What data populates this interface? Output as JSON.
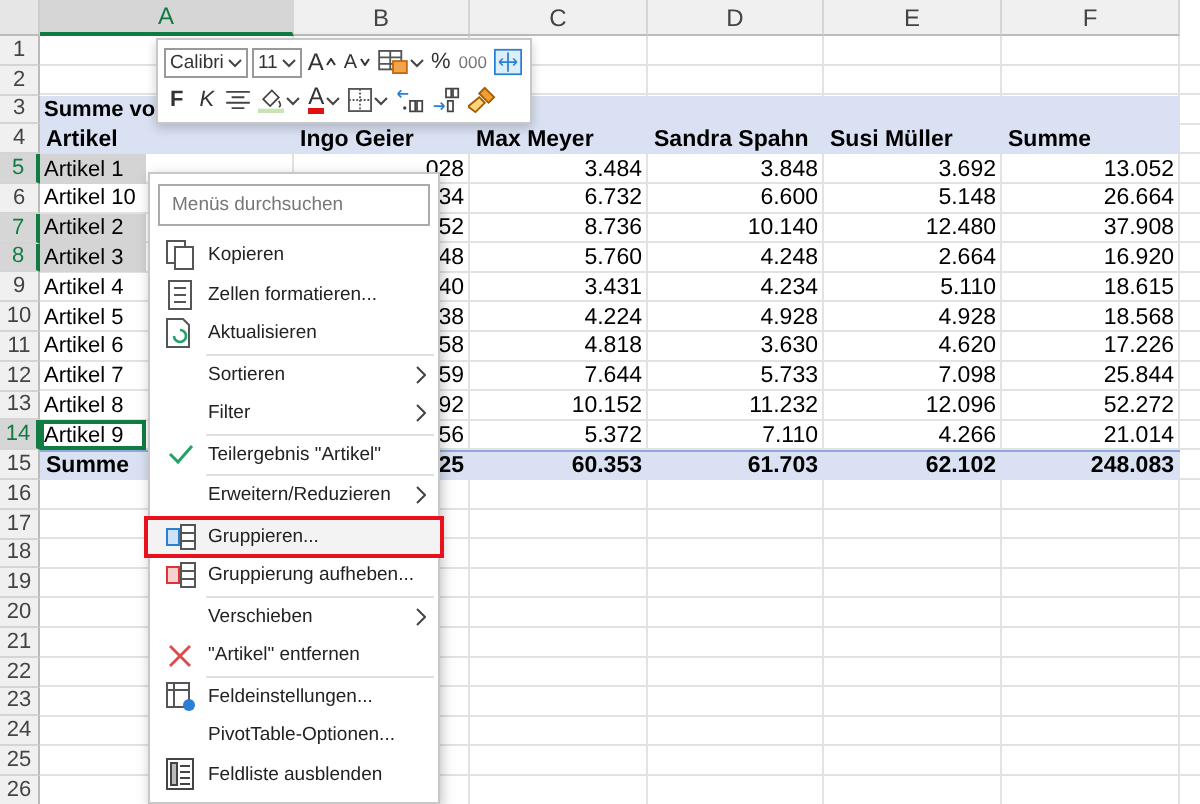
{
  "columns": [
    {
      "label": "A",
      "selected": true
    },
    {
      "label": "B",
      "selected": false
    },
    {
      "label": "C",
      "selected": false
    },
    {
      "label": "D",
      "selected": false
    },
    {
      "label": "E",
      "selected": false
    },
    {
      "label": "F",
      "selected": false
    }
  ],
  "row_headers": [
    {
      "label": "1",
      "selected": false
    },
    {
      "label": "2",
      "selected": false
    },
    {
      "label": "3",
      "selected": false
    },
    {
      "label": "4",
      "selected": false
    },
    {
      "label": "5",
      "selected": true
    },
    {
      "label": "6",
      "selected": false
    },
    {
      "label": "7",
      "selected": true
    },
    {
      "label": "8",
      "selected": true
    },
    {
      "label": "9",
      "selected": false
    },
    {
      "label": "10",
      "selected": false
    },
    {
      "label": "11",
      "selected": false
    },
    {
      "label": "12",
      "selected": false
    },
    {
      "label": "13",
      "selected": false
    },
    {
      "label": "14",
      "selected": true
    },
    {
      "label": "15",
      "selected": false
    },
    {
      "label": "16",
      "selected": false
    },
    {
      "label": "17",
      "selected": false
    },
    {
      "label": "18",
      "selected": false
    },
    {
      "label": "19",
      "selected": false
    },
    {
      "label": "20",
      "selected": false
    },
    {
      "label": "21",
      "selected": false
    },
    {
      "label": "22",
      "selected": false
    },
    {
      "label": "23",
      "selected": false
    },
    {
      "label": "24",
      "selected": false
    },
    {
      "label": "25",
      "selected": false
    },
    {
      "label": "26",
      "selected": false
    }
  ],
  "pivot": {
    "title": "Summe vo",
    "header": [
      "Artikel",
      "Ingo Geier",
      "Max Meyer",
      "Sandra Spahn",
      "Susi Müller",
      "Summe"
    ],
    "rows": [
      {
        "cells": [
          "Artikel 1",
          "028",
          "3.484",
          "3.848",
          "3.692",
          "13.052"
        ],
        "selected": true,
        "active": false
      },
      {
        "cells": [
          "Artikel 10",
          "34",
          "6.732",
          "6.600",
          "5.148",
          "26.664"
        ],
        "selected": false,
        "active": false
      },
      {
        "cells": [
          "Artikel 2",
          "52",
          "8.736",
          "10.140",
          "12.480",
          "37.908"
        ],
        "selected": true,
        "active": false
      },
      {
        "cells": [
          "Artikel 3",
          "48",
          "5.760",
          "4.248",
          "2.664",
          "16.920"
        ],
        "selected": true,
        "active": false
      },
      {
        "cells": [
          "Artikel 4",
          "40",
          "3.431",
          "4.234",
          "5.110",
          "18.615"
        ],
        "selected": false,
        "active": false
      },
      {
        "cells": [
          "Artikel 5",
          "38",
          "4.224",
          "4.928",
          "4.928",
          "18.568"
        ],
        "selected": false,
        "active": false
      },
      {
        "cells": [
          "Artikel 6",
          "58",
          "4.818",
          "3.630",
          "4.620",
          "17.226"
        ],
        "selected": false,
        "active": false
      },
      {
        "cells": [
          "Artikel 7",
          "59",
          "7.644",
          "5.733",
          "7.098",
          "25.844"
        ],
        "selected": false,
        "active": false
      },
      {
        "cells": [
          "Artikel 8",
          "92",
          "10.152",
          "11.232",
          "12.096",
          "52.272"
        ],
        "selected": false,
        "active": false
      },
      {
        "cells": [
          "Artikel 9",
          "56",
          "5.372",
          "7.110",
          "4.266",
          "21.014"
        ],
        "selected": false,
        "active": true
      }
    ],
    "total": [
      "Summe",
      "25",
      "60.353",
      "61.703",
      "62.102",
      "248.083"
    ]
  },
  "mini_toolbar": {
    "font": "Calibri",
    "size": "11",
    "grow_font": "A",
    "shrink_font": "A",
    "percent": "%",
    "thousands": "000",
    "bold": "F",
    "italic": "K",
    "font_color": "A"
  },
  "context_menu": {
    "search": {
      "placeholder": "Menüs durchsuchen"
    },
    "items": [
      {
        "kind": "item",
        "label": "Kopieren",
        "checked": false,
        "submenu": false,
        "selected": false
      },
      {
        "kind": "item",
        "label": "Zellen formatieren...",
        "checked": false,
        "submenu": false,
        "selected": false
      },
      {
        "kind": "item",
        "label": "Aktualisieren",
        "checked": false,
        "submenu": false,
        "selected": false
      },
      {
        "kind": "separator"
      },
      {
        "kind": "item",
        "label": "Sortieren",
        "checked": false,
        "submenu": true,
        "selected": false
      },
      {
        "kind": "item",
        "label": "Filter",
        "checked": false,
        "submenu": true,
        "selected": false
      },
      {
        "kind": "separator"
      },
      {
        "kind": "item",
        "label": "Teilergebnis \"Artikel\"",
        "checked": true,
        "submenu": false,
        "selected": false
      },
      {
        "kind": "separator"
      },
      {
        "kind": "item",
        "label": "Erweitern/Reduzieren",
        "checked": false,
        "submenu": true,
        "selected": false
      },
      {
        "kind": "separator"
      },
      {
        "kind": "item",
        "label": "Gruppieren...",
        "checked": false,
        "submenu": false,
        "selected": true
      },
      {
        "kind": "item",
        "label": "Gruppierung aufheben...",
        "checked": false,
        "submenu": false,
        "selected": false
      },
      {
        "kind": "separator"
      },
      {
        "kind": "item",
        "label": "Verschieben",
        "checked": false,
        "submenu": true,
        "selected": false
      },
      {
        "kind": "item",
        "label": "\"Artikel\" entfernen",
        "checked": false,
        "submenu": false,
        "selected": false
      },
      {
        "kind": "separator"
      },
      {
        "kind": "item",
        "label": "Feldeinstellungen...",
        "checked": false,
        "submenu": false,
        "selected": false
      },
      {
        "kind": "item",
        "label": "PivotTable-Optionen...",
        "checked": false,
        "submenu": false,
        "selected": false
      },
      {
        "kind": "item",
        "label": "Feldliste ausblenden",
        "checked": false,
        "submenu": false,
        "selected": false
      }
    ]
  }
}
